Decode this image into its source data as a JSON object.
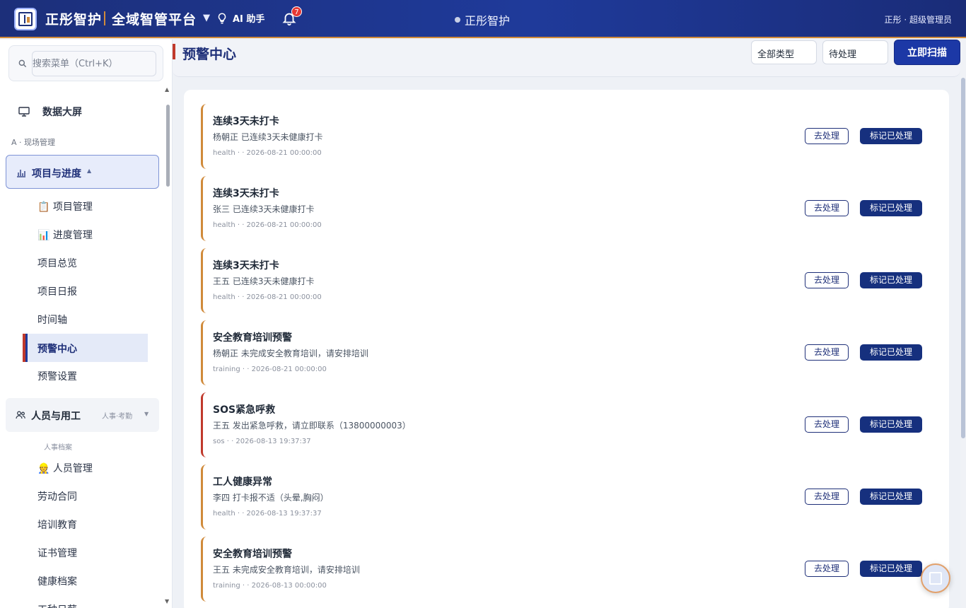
{
  "header": {
    "brand": "正彤智护",
    "platform": "全域智管平台",
    "ai_label": "AI 助手",
    "notification_count": "7",
    "center_title": "正彤智护",
    "user": "正彤 · 超级管理员"
  },
  "sidebar": {
    "search_placeholder": "搜索菜单（Ctrl+K）",
    "dashboard": "数据大屏",
    "section_label": "A · 现场管理",
    "group1": {
      "label": "项目与进度",
      "items": [
        "📋 项目管理",
        "📊 进度管理",
        "项目总览",
        "项目日报",
        "时间轴",
        "预警中心",
        "预警设置"
      ],
      "active_index": 5
    },
    "group2": {
      "label": "人员与用工",
      "tag": "人事·考勤",
      "sub_label": "人事档案",
      "items": [
        "👷 人员管理",
        "劳动合同",
        "培训教育",
        "证书管理",
        "健康档案",
        "工种日薪"
      ]
    }
  },
  "page": {
    "title": "预警中心",
    "filter_type": "全部类型",
    "filter_status": "待处理",
    "scan_button": "立即扫描"
  },
  "alert_actions": {
    "go": "去处理",
    "done": "标记已处理"
  },
  "alerts": [
    {
      "title": "连续3天未打卡",
      "desc": "杨朝正 已连续3天未健康打卡",
      "meta": "health · · 2026-08-21 00:00:00",
      "kind": "warn"
    },
    {
      "title": "连续3天未打卡",
      "desc": "张三 已连续3天未健康打卡",
      "meta": "health · · 2026-08-21 00:00:00",
      "kind": "warn"
    },
    {
      "title": "连续3天未打卡",
      "desc": "王五 已连续3天未健康打卡",
      "meta": "health · · 2026-08-21 00:00:00",
      "kind": "warn"
    },
    {
      "title": "安全教育培训预警",
      "desc": "杨朝正 未完成安全教育培训，请安排培训",
      "meta": "training · · 2026-08-21 00:00:00",
      "kind": "warn"
    },
    {
      "title": "SOS紧急呼救",
      "desc": "王五 发出紧急呼救，请立即联系（13800000003）",
      "meta": "sos · · 2026-08-13 19:37:37",
      "kind": "sos"
    },
    {
      "title": "工人健康异常",
      "desc": "李四 打卡报不适（头晕,胸闷）",
      "meta": "health · · 2026-08-13 19:37:37",
      "kind": "warn"
    },
    {
      "title": "安全教育培训预警",
      "desc": "王五 未完成安全教育培训，请安排培训",
      "meta": "training · · 2026-08-13 00:00:00",
      "kind": "warn"
    }
  ]
}
